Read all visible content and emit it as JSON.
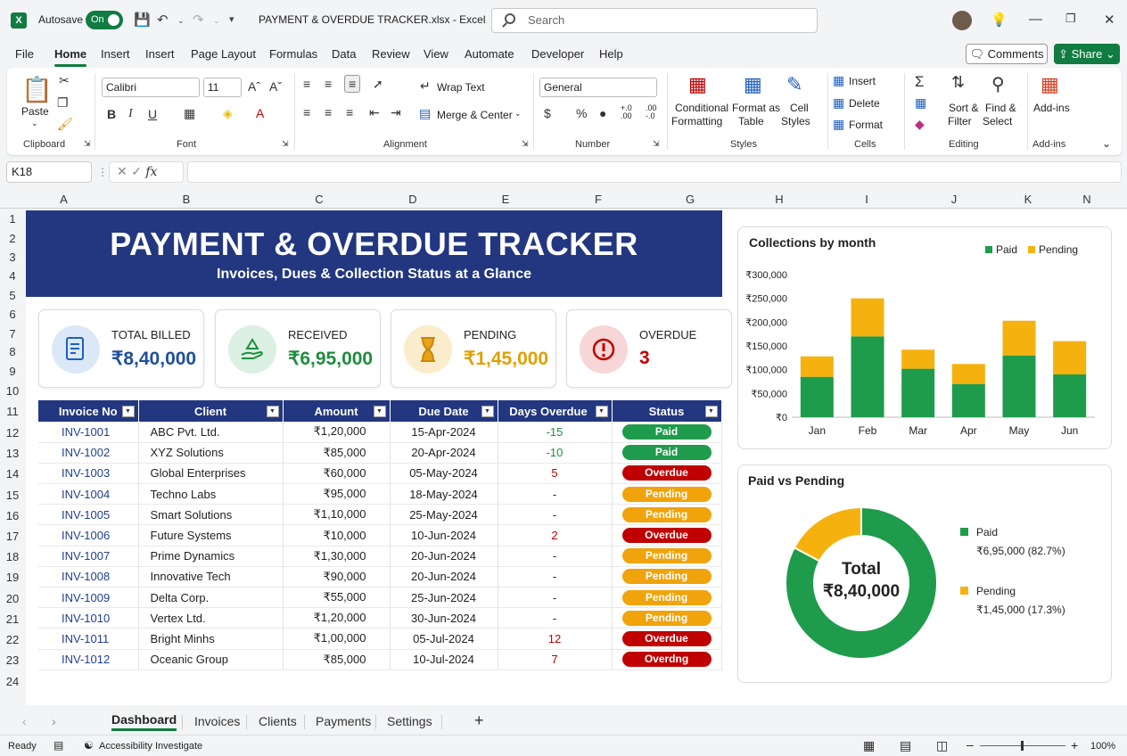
{
  "window": {
    "autosave_label": "Autosave",
    "autosave_state": "On",
    "title": "PAYMENT & OVERDUE TRACKER.xlsx  -  Excel",
    "search_placeholder": "Search"
  },
  "menu": [
    "File",
    "Home",
    "Insert",
    "Insert",
    "Page Layout",
    "Formulas",
    "Data",
    "Review",
    "View",
    "Automate",
    "Developer",
    "Help"
  ],
  "buttons": {
    "comments": "Comments",
    "share": "Share"
  },
  "ribbon": {
    "paste": "Paste",
    "clipboard": "Clipboard",
    "font_name": "Calibri",
    "font_size": "11",
    "font": "Font",
    "wrap_text": "Wrap Text",
    "merge_center": "Merge & Center",
    "alignment": "Alignment",
    "number_format": "General",
    "number": "Number",
    "conditional": "Conditional",
    "formatting": "Formatting",
    "format_as": "Format as",
    "table": "Table",
    "cell": "Cell",
    "styles_btn": "Styles",
    "styles": "Styles",
    "insert": "Insert",
    "delete": "Delete",
    "format": "Format",
    "cells": "Cells",
    "sort": "Sort &",
    "filter": "Filter",
    "find": "Find &",
    "select": "Select",
    "editing": "Editing",
    "addins": "Add-ins",
    "addins_group": "Add-ins"
  },
  "formula_bar": {
    "name_box": "K18",
    "fx": "fx",
    "value": ""
  },
  "columns": [
    "A",
    "B",
    "C",
    "D",
    "E",
    "F",
    "G",
    "H",
    "I",
    "J",
    "K",
    "N"
  ],
  "rows": [
    "1",
    "2",
    "3",
    "4",
    "5",
    "6",
    "7",
    "8",
    "9",
    "10",
    "11",
    "12",
    "13",
    "14",
    "15",
    "16",
    "17",
    "18",
    "19",
    "20",
    "21",
    "22",
    "23",
    "24"
  ],
  "dashboard": {
    "title": "PAYMENT & OVERDUE TRACKER",
    "subtitle": "Invoices, Dues & Collection Status at a Glance",
    "kpis": [
      {
        "label": "TOTAL BILLED",
        "value": "₹8,40,000",
        "color": "#1f4e9c",
        "icon": "invoice-icon"
      },
      {
        "label": "RECEIVED",
        "value": "₹6,95,000",
        "color": "#1e8e3e",
        "icon": "hand-money-icon"
      },
      {
        "label": "PENDING",
        "value": "₹1,45,000",
        "color": "#e0a000",
        "icon": "hourglass-icon"
      },
      {
        "label": "OVERDUE",
        "value": "3",
        "color": "#c00000",
        "icon": "alert-icon"
      }
    ],
    "table_headers": [
      "Invoice No",
      "Client",
      "Amount",
      "Due Date",
      "Days Overdue",
      "Status"
    ],
    "invoices": [
      {
        "inv": "INV-1001",
        "client": "ABC Pvt. Ltd.",
        "amount": "₹1,20,000",
        "due": "15-Apr-2024",
        "days": "-15",
        "status": "Paid"
      },
      {
        "inv": "INV-1002",
        "client": "XYZ Solutions",
        "amount": "₹85,000",
        "due": "20-Apr-2024",
        "days": "-10",
        "status": "Paid"
      },
      {
        "inv": "INV-1003",
        "client": "Global Enterprises",
        "amount": "₹60,000",
        "due": "05-May-2024",
        "days": "5",
        "status": "Overdue"
      },
      {
        "inv": "INV-1004",
        "client": "Techno Labs",
        "amount": "₹95,000",
        "due": "18-May-2024",
        "days": "-",
        "status": "Pending"
      },
      {
        "inv": "INV-1005",
        "client": "Smart Solutions",
        "amount": "₹1,10,000",
        "due": "25-May-2024",
        "days": "-",
        "status": "Pending"
      },
      {
        "inv": "INV-1006",
        "client": "Future Systems",
        "amount": "₹10,000",
        "due": "10-Jun-2024",
        "days": "2",
        "status": "Overdue"
      },
      {
        "inv": "INV-1007",
        "client": "Prime Dynamics",
        "amount": "₹1,30,000",
        "due": "20-Jun-2024",
        "days": "-",
        "status": "Pending"
      },
      {
        "inv": "INV-1008",
        "client": "Innovative Tech",
        "amount": "₹90,000",
        "due": "20-Jun-2024",
        "days": "-",
        "status": "Pending"
      },
      {
        "inv": "INV-1009",
        "client": "Delta Corp.",
        "amount": "₹55,000",
        "due": "25-Jun-2024",
        "days": "-",
        "status": "Pending"
      },
      {
        "inv": "INV-1010",
        "client": "Vertex Ltd.",
        "amount": "₹1,20,000",
        "due": "30-Jun-2024",
        "days": "-",
        "status": "Pending"
      },
      {
        "inv": "INV-1011",
        "client": "Bright Minhs",
        "amount": "₹1,00,000",
        "due": "05-Jul-2024",
        "days": "12",
        "status": "Overdue"
      },
      {
        "inv": "INV-1012",
        "client": "Oceanic Group",
        "amount": "₹85,000",
        "due": "10-Jul-2024",
        "days": "7",
        "status": "Overdng"
      }
    ]
  },
  "chart_data": [
    {
      "type": "bar",
      "stacked": true,
      "title": "Collections by month",
      "categories": [
        "Jan",
        "Feb",
        "Mar",
        "Apr",
        "May",
        "Jun"
      ],
      "series": [
        {
          "name": "Paid",
          "color": "#1e9b4b",
          "values": [
            85000,
            170000,
            102000,
            70000,
            130000,
            90000
          ]
        },
        {
          "name": "Pending",
          "color": "#f5b20f",
          "values": [
            43000,
            80000,
            40000,
            42000,
            73000,
            70000
          ]
        }
      ],
      "yticks": [
        "₹300,000",
        "₹250,000",
        "₹200,000",
        "₹150,000",
        "₹100,000",
        "₹50,000",
        "₹0"
      ],
      "ylim": [
        0,
        300000
      ],
      "legend": "top-right"
    },
    {
      "type": "pie",
      "donut": true,
      "title": "Paid vs Pending",
      "center_label": "Total",
      "center_value": "₹8,40,000",
      "slices": [
        {
          "name": "Paid",
          "value": 695000,
          "label": "₹6,95,000 (82.7%)",
          "color": "#1e9b4b"
        },
        {
          "name": "Pending",
          "value": 145000,
          "label": "₹1,45,000 (17.3%)",
          "color": "#f5b20f"
        }
      ],
      "legend": "right"
    }
  ],
  "sheet_tabs": [
    "Dashboard",
    "Invoices",
    "Clients",
    "Payments",
    "Settings"
  ],
  "status_bar": {
    "ready": "Ready",
    "accessibility": "Accessibility Investigate",
    "zoom": "100%"
  }
}
